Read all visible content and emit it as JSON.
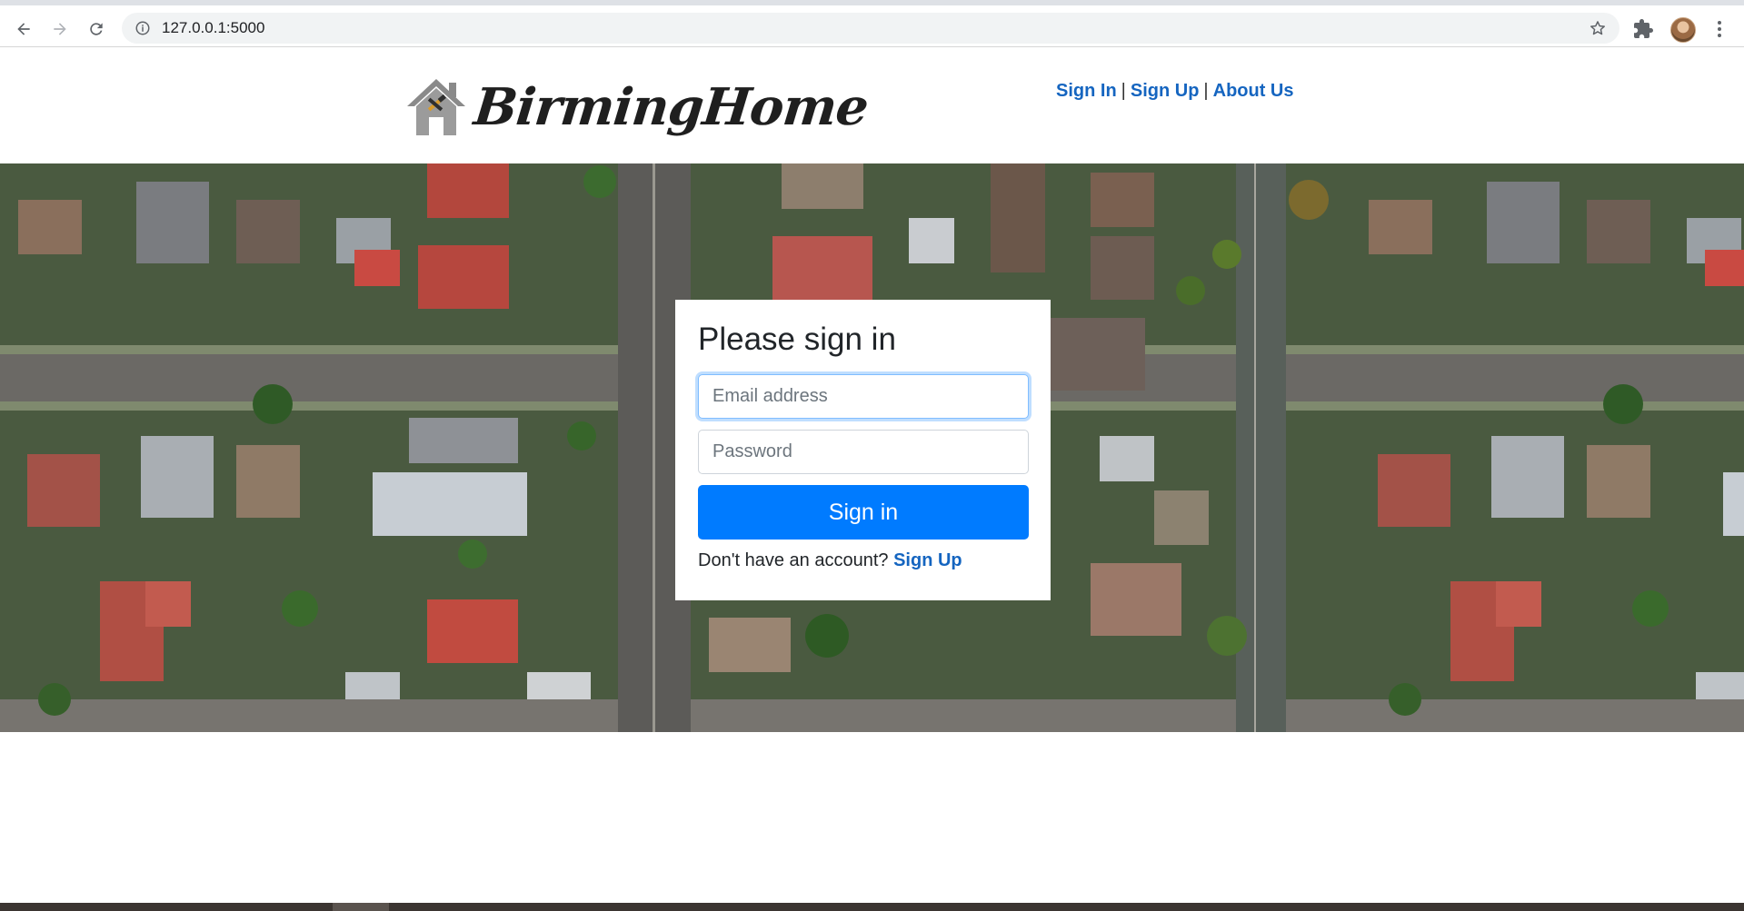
{
  "browser": {
    "url": "127.0.0.1:5000"
  },
  "site": {
    "logo_text": "BirmingHome",
    "nav": {
      "sign_in": "Sign In",
      "separator": "|",
      "sign_up": "Sign Up",
      "about_us": "About Us"
    }
  },
  "login": {
    "heading": "Please sign in",
    "email_placeholder": "Email address",
    "password_placeholder": "Password",
    "submit_label": "Sign in",
    "no_account_text": "Don't have an account?",
    "signup_link": "Sign Up"
  },
  "colors": {
    "primary": "#007bff",
    "link": "#1565c0",
    "heading": "#212529"
  }
}
